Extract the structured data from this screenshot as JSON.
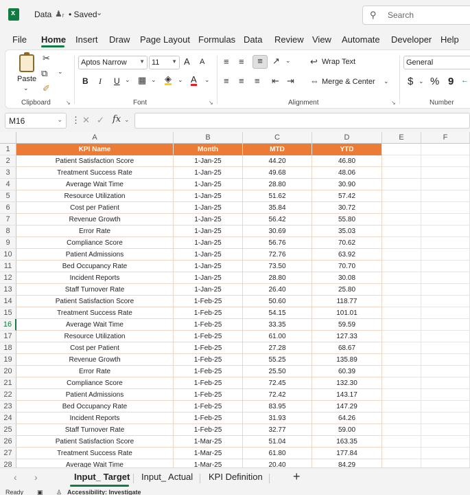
{
  "titlebar": {
    "doc_name": "Data",
    "saved_label": "• Saved",
    "search_placeholder": "Search"
  },
  "menu": {
    "tabs": [
      "File",
      "Home",
      "Insert",
      "Draw",
      "Page Layout",
      "Formulas",
      "Data",
      "Review",
      "View",
      "Automate",
      "Developer",
      "Help"
    ],
    "active": "Home"
  },
  "ribbon": {
    "clipboard": {
      "paste_label": "Paste",
      "group_label": "Clipboard"
    },
    "font": {
      "font_name": "Aptos Narrow",
      "font_size": "11",
      "bold": "B",
      "italic": "I",
      "underline": "U",
      "grow": "A",
      "shrink": "A",
      "group_label": "Font"
    },
    "alignment": {
      "wrap_text": "Wrap Text",
      "merge_center": "Merge & Center",
      "group_label": "Alignment"
    },
    "number": {
      "format": "General",
      "currency": "$",
      "percent": "%",
      "comma": "9",
      "group_label": "Number"
    }
  },
  "formula_bar": {
    "name_box": "M16",
    "fx_label": "fx",
    "formula": ""
  },
  "sheet": {
    "columns": [
      "A",
      "B",
      "C",
      "D",
      "E",
      "F"
    ],
    "header_row": [
      "KPI Name",
      "Month",
      "MTD",
      "YTD"
    ],
    "selected_row": 16,
    "rows": [
      [
        "Patient Satisfaction Score",
        "1-Jan-25",
        "44.20",
        "46.80"
      ],
      [
        "Treatment Success Rate",
        "1-Jan-25",
        "49.68",
        "48.06"
      ],
      [
        "Average Wait Time",
        "1-Jan-25",
        "28.80",
        "30.90"
      ],
      [
        "Resource Utilization",
        "1-Jan-25",
        "51.62",
        "57.42"
      ],
      [
        "Cost per Patient",
        "1-Jan-25",
        "35.84",
        "30.72"
      ],
      [
        "Revenue Growth",
        "1-Jan-25",
        "56.42",
        "55.80"
      ],
      [
        "Error Rate",
        "1-Jan-25",
        "30.69",
        "35.03"
      ],
      [
        "Compliance Score",
        "1-Jan-25",
        "56.76",
        "70.62"
      ],
      [
        "Patient Admissions",
        "1-Jan-25",
        "72.76",
        "63.92"
      ],
      [
        "Bed Occupancy Rate",
        "1-Jan-25",
        "73.50",
        "70.70"
      ],
      [
        "Incident Reports",
        "1-Jan-25",
        "28.80",
        "30.08"
      ],
      [
        "Staff Turnover Rate",
        "1-Jan-25",
        "26.40",
        "25.80"
      ],
      [
        "Patient Satisfaction Score",
        "1-Feb-25",
        "50.60",
        "118.77"
      ],
      [
        "Treatment Success Rate",
        "1-Feb-25",
        "54.15",
        "101.01"
      ],
      [
        "Average Wait Time",
        "1-Feb-25",
        "33.35",
        "59.59"
      ],
      [
        "Resource Utilization",
        "1-Feb-25",
        "61.00",
        "127.33"
      ],
      [
        "Cost per Patient",
        "1-Feb-25",
        "27.28",
        "68.67"
      ],
      [
        "Revenue Growth",
        "1-Feb-25",
        "55.25",
        "135.89"
      ],
      [
        "Error Rate",
        "1-Feb-25",
        "25.50",
        "60.39"
      ],
      [
        "Compliance Score",
        "1-Feb-25",
        "72.45",
        "132.30"
      ],
      [
        "Patient Admissions",
        "1-Feb-25",
        "72.42",
        "143.17"
      ],
      [
        "Bed Occupancy Rate",
        "1-Feb-25",
        "83.95",
        "147.29"
      ],
      [
        "Incident Reports",
        "1-Feb-25",
        "31.93",
        "64.26"
      ],
      [
        "Staff Turnover Rate",
        "1-Feb-25",
        "32.77",
        "59.00"
      ],
      [
        "Patient Satisfaction Score",
        "1-Mar-25",
        "51.04",
        "163.35"
      ],
      [
        "Treatment Success Rate",
        "1-Mar-25",
        "61.80",
        "177.84"
      ],
      [
        "Average Wait Time",
        "1-Mar-25",
        "20.40",
        "84.29"
      ]
    ]
  },
  "sheet_tabs": {
    "tabs": [
      "Input_ Target",
      "Input_ Actual",
      "KPI Definition"
    ],
    "active": "Input_ Target",
    "add_label": "+"
  },
  "status": {
    "ready": "Ready",
    "accessibility": "Accessibility: Investigate"
  },
  "colors": {
    "header_fill": "#ec7b35",
    "accent": "#107c41"
  }
}
